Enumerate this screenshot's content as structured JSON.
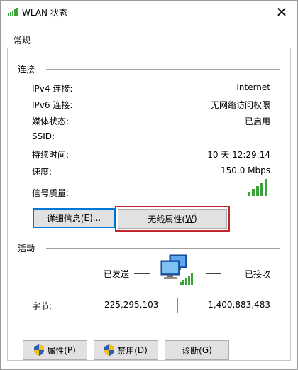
{
  "window": {
    "title": "WLAN 状态",
    "close_glyph": "✕"
  },
  "tabs": [
    {
      "label": "常规"
    }
  ],
  "connection": {
    "section_title": "连接",
    "rows": [
      {
        "label": "IPv4 连接:",
        "value": "Internet"
      },
      {
        "label": "IPv6 连接:",
        "value": "无网络访问权限"
      },
      {
        "label": "媒体状态:",
        "value": "已启用"
      },
      {
        "label": "SSID:",
        "value": ""
      },
      {
        "label": "持续时间:",
        "value": "10 天 12:29:14"
      },
      {
        "label": "速度:",
        "value": "150.0 Mbps"
      }
    ],
    "signal_label": "信号质量:",
    "signal_bars": 5,
    "signal_bars_filled": 5,
    "details_button": {
      "pre": "详细信息(",
      "key": "E",
      "post": ")..."
    },
    "wireless_props_button": {
      "pre": "无线属性(",
      "key": "W",
      "post": ")"
    }
  },
  "activity": {
    "section_title": "活动",
    "sent_label": "已发送",
    "received_label": "已接收",
    "bytes_label": "字节:",
    "bytes_sent": "225,295,103",
    "bytes_received": "1,400,883,483"
  },
  "bottom_buttons": {
    "properties": {
      "pre": "属性(",
      "key": "P",
      "post": ")"
    },
    "disable": {
      "pre": "禁用(",
      "key": "D",
      "post": ")"
    },
    "diagnose": {
      "pre": "诊断(",
      "key": "G",
      "post": ")"
    }
  },
  "colors": {
    "signal_green": "#3aa33a",
    "highlight_red": "#c0262d",
    "focus_blue": "#0078d7",
    "shield_blue": "#2a5db0",
    "shield_yellow": "#f3c21b"
  }
}
